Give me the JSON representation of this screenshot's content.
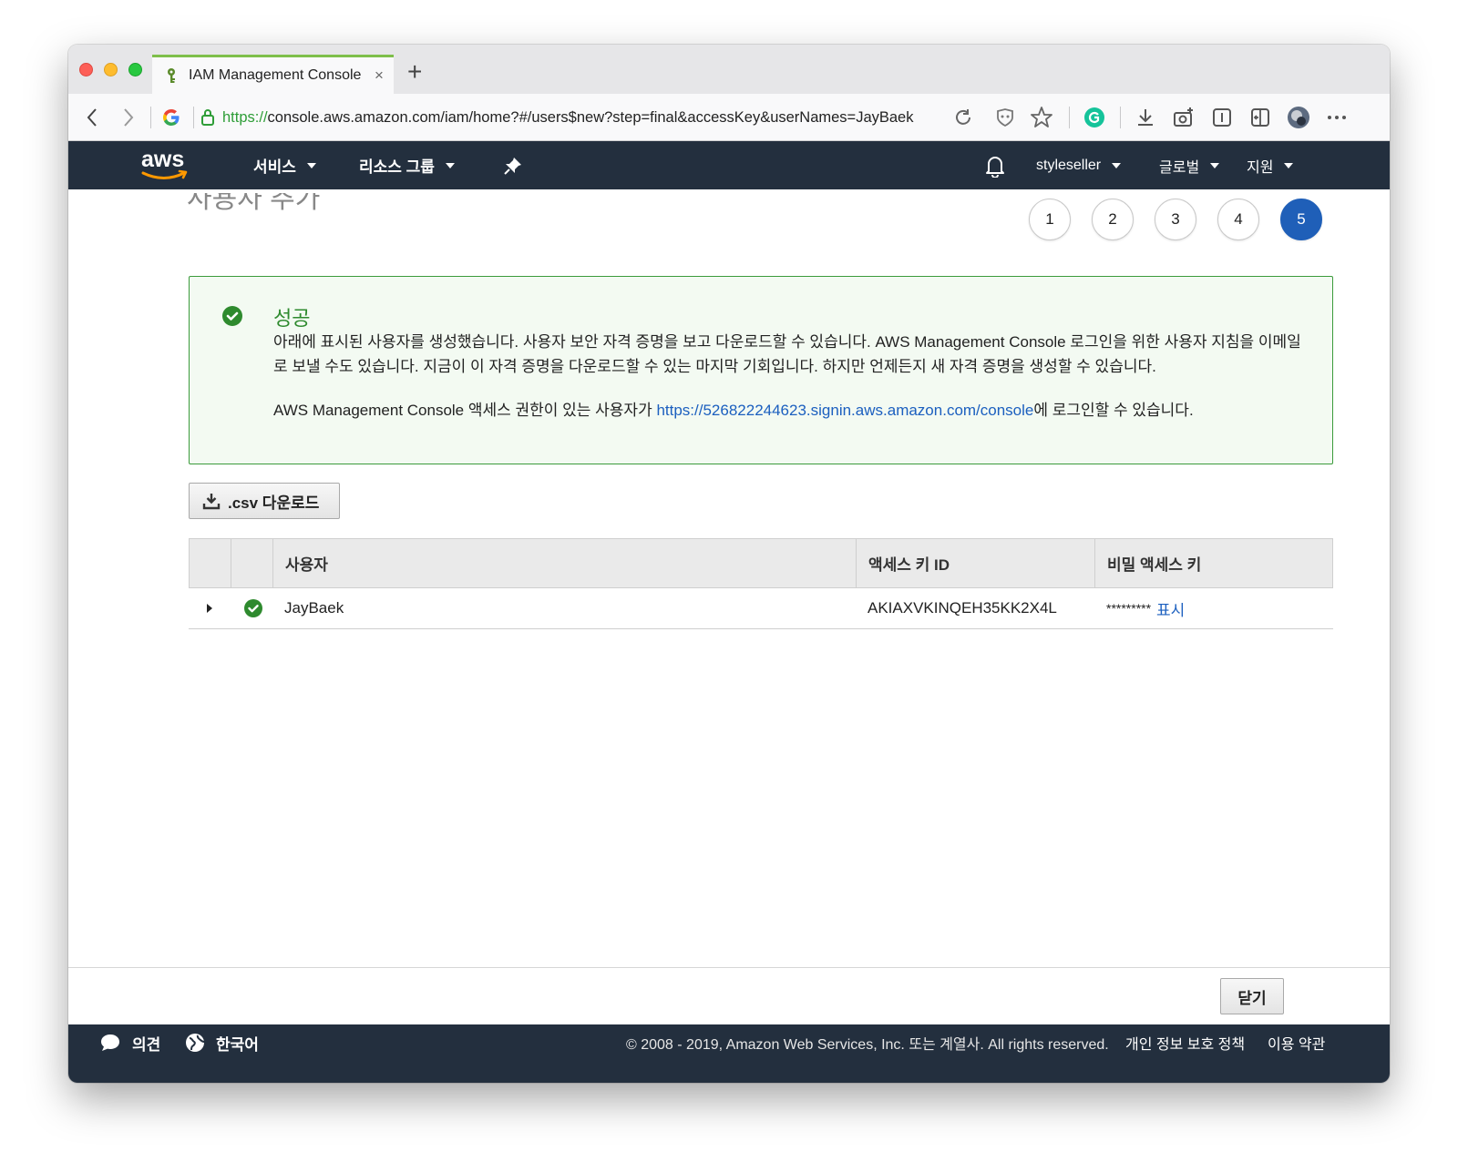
{
  "browser": {
    "tab_title": "IAM Management Console",
    "tab_close": "×",
    "new_tab": "+",
    "url_scheme": "https://",
    "url_rest": "console.aws.amazon.com/iam/home?#/users$new?step=final&accessKey&userNames=JayBaek"
  },
  "aws_header": {
    "logo_text": "aws",
    "services": "서비스",
    "resource_groups": "리소스 그룹",
    "account": "styleseller",
    "region": "글로벌",
    "support": "지원"
  },
  "page": {
    "title": "사용자 추가",
    "steps": [
      "1",
      "2",
      "3",
      "4",
      "5"
    ],
    "active_step": "5"
  },
  "success": {
    "title": "성공",
    "message": "아래에 표시된 사용자를 생성했습니다. 사용자 보안 자격 증명을 보고 다운로드할 수 있습니다. AWS Management Console 로그인을 위한 사용자 지침을 이메일로 보낼 수도 있습니다. 지금이 이 자격 증명을 다운로드할 수 있는 마지막 기회입니다. 하지만 언제든지 새 자격 증명을 생성할 수 있습니다.",
    "console_prefix": "AWS Management Console 액세스 권한이 있는 사용자가 ",
    "console_url": "https://526822244623.signin.aws.amazon.com/console",
    "console_suffix": "에 로그인할 수 있습니다."
  },
  "csv_button": ".csv 다운로드",
  "table": {
    "columns": [
      "사용자",
      "액세스 키 ID",
      "비밀 액세스 키"
    ],
    "rows": [
      {
        "user": "JayBaek",
        "access_key_id": "AKIAXVKINQEH35KK2X4L",
        "secret_masked": "*********",
        "show": "표시"
      }
    ]
  },
  "close_button": "닫기",
  "footer": {
    "feedback": "의견",
    "language": "한국어",
    "copyright": "© 2008 - 2019, Amazon Web Services, Inc. 또는 계열사. All rights reserved.",
    "privacy": "개인 정보 보호 정책",
    "terms": "이용 약관"
  },
  "colors": {
    "aws_bar": "#232f3e",
    "aws_orange": "#ff9900",
    "success_green": "#2e8a2e",
    "link_blue": "#1b5fbf",
    "active_step": "#1f5fb8"
  }
}
